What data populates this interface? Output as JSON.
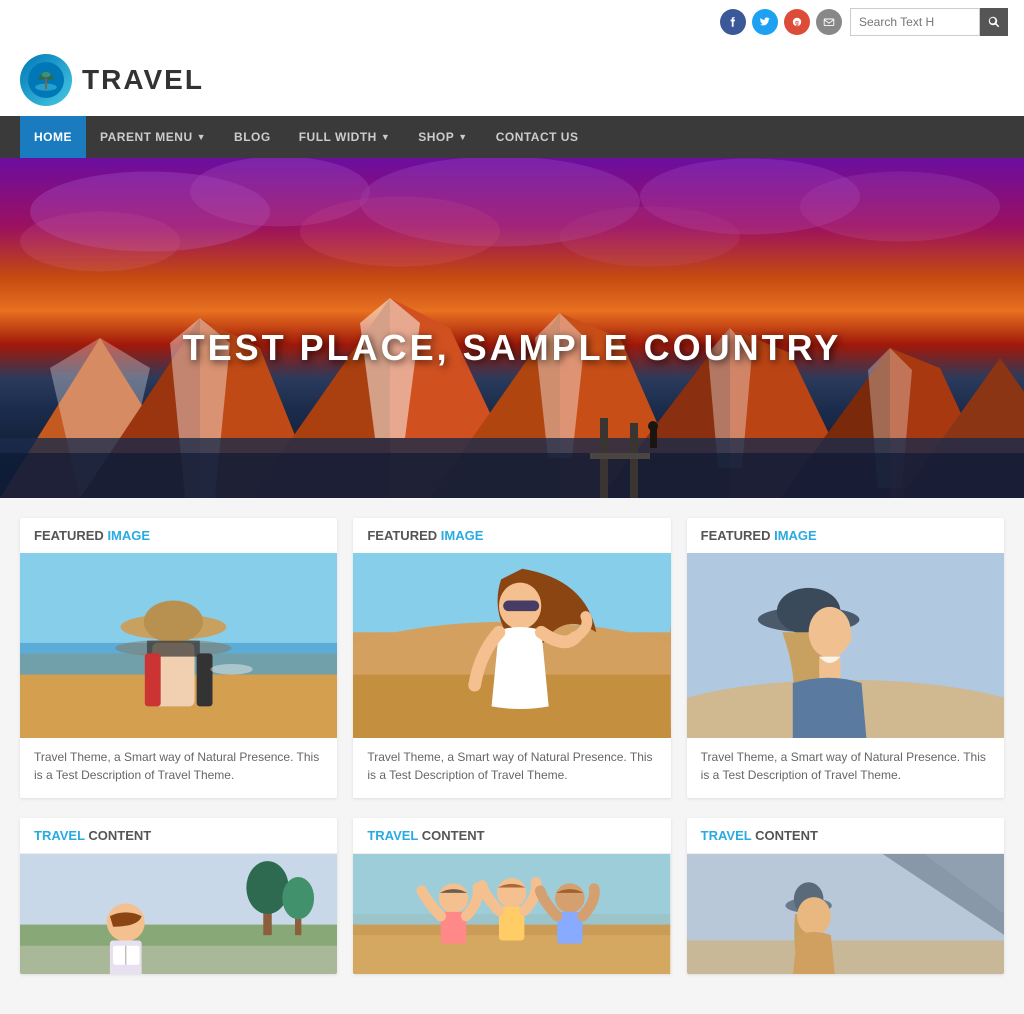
{
  "site": {
    "title": "TRAVEL"
  },
  "topbar": {
    "search_placeholder": "Search Text H",
    "social": [
      {
        "name": "facebook",
        "icon": "f"
      },
      {
        "name": "twitter",
        "icon": "t"
      },
      {
        "name": "google",
        "icon": "g"
      },
      {
        "name": "email",
        "icon": "@"
      }
    ]
  },
  "nav": {
    "items": [
      {
        "label": "HOME",
        "active": true,
        "has_arrow": false
      },
      {
        "label": "PARENT MENU",
        "active": false,
        "has_arrow": true
      },
      {
        "label": "BLOG",
        "active": false,
        "has_arrow": false
      },
      {
        "label": "FULL WIDTH",
        "active": false,
        "has_arrow": true
      },
      {
        "label": "SHOP",
        "active": false,
        "has_arrow": true
      },
      {
        "label": "CONTACT US",
        "active": false,
        "has_arrow": false
      }
    ]
  },
  "hero": {
    "title": "TEST PLACE, SAMPLE COUNTRY"
  },
  "featured_cards": [
    {
      "label_static": "FEATURED ",
      "label_accent": "IMAGE",
      "description": "Travel Theme, a Smart way of Natural Presence. This is a Test Description of Travel Theme."
    },
    {
      "label_static": "FEATURED ",
      "label_accent": "IMAGE",
      "description": "Travel Theme, a Smart way of Natural Presence. This is a Test Description of Travel Theme."
    },
    {
      "label_static": "FEATURED ",
      "label_accent": "IMAGE",
      "description": "Travel Theme, a Smart way of Natural Presence. This is a Test Description of Travel Theme."
    }
  ],
  "travel_cards": [
    {
      "label_static": "TRAVEL ",
      "label_accent": "CONTENT"
    },
    {
      "label_static": "TRAVEL ",
      "label_accent": "CONTENT"
    },
    {
      "label_static": "TRAVEL ",
      "label_accent": "CONTENT"
    }
  ],
  "colors": {
    "nav_bg": "#3a3a3a",
    "nav_active": "#1a7bbf",
    "accent": "#29abe2"
  }
}
